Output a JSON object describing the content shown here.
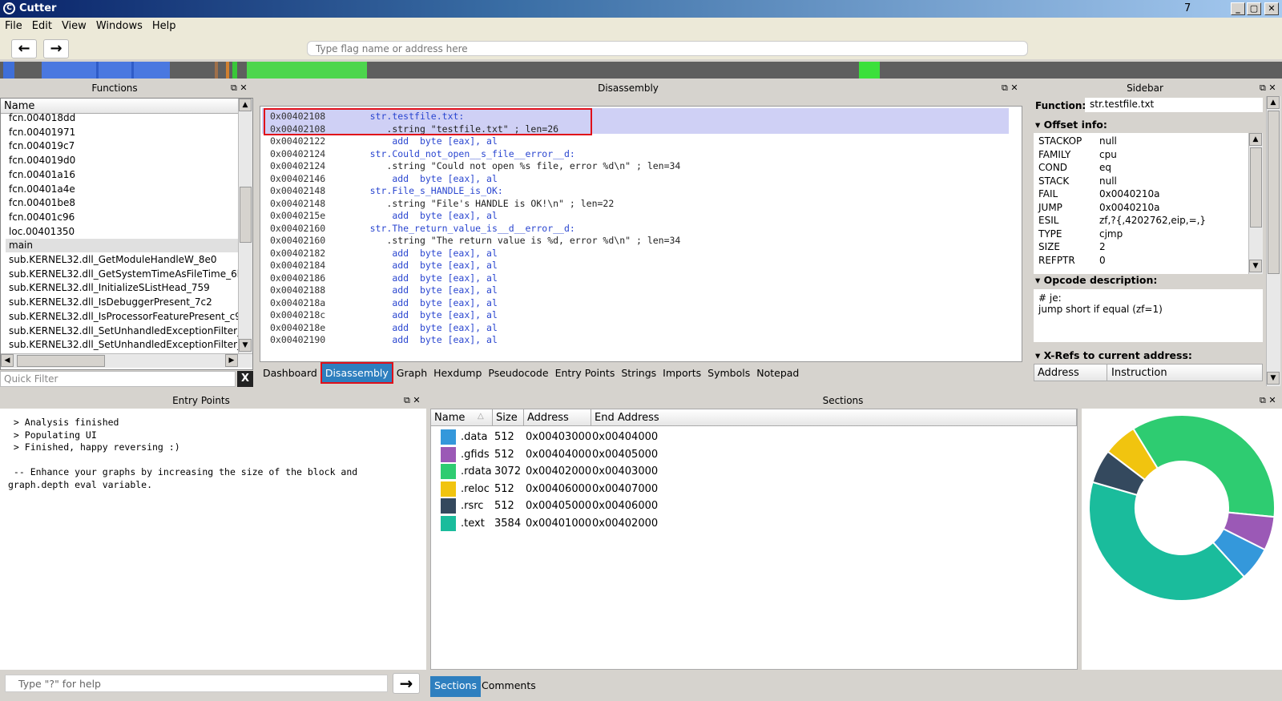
{
  "app": {
    "title": "Cutter",
    "title_number": "7",
    "logo": "C"
  },
  "window_controls": [
    "_",
    "▢",
    "✕"
  ],
  "menu": [
    "File",
    "Edit",
    "View",
    "Windows",
    "Help"
  ],
  "toolbar": {
    "back_icon": "←",
    "forward_icon": "→",
    "search_placeholder": "Type flag name or address here"
  },
  "panels": {
    "functions": "Functions",
    "disassembly": "Disassembly",
    "sidebar": "Sidebar",
    "entry_points": "Entry Points",
    "sections": "Sections"
  },
  "functions": {
    "header": "Name",
    "items": [
      "fcn.004018dd",
      "fcn.00401971",
      "fcn.004019c7",
      "fcn.004019d0",
      "fcn.00401a16",
      "fcn.00401a4e",
      "fcn.00401be8",
      "fcn.00401c96",
      "loc.00401350",
      "main",
      "sub.KERNEL32.dll_GetModuleHandleW_8e0",
      "sub.KERNEL32.dll_GetSystemTimeAsFileTime_6b3",
      "sub.KERNEL32.dll_InitializeSListHead_759",
      "sub.KERNEL32.dll_IsDebuggerPresent_7c2",
      "sub.KERNEL32.dll_IsProcessorFeaturePresent_c90",
      "sub.KERNEL32.dll_SetUnhandledExceptionFilter_328",
      "sub.KERNEL32.dll_SetUnhandledExceptionFilter_924"
    ],
    "selected": "main",
    "filter_placeholder": "Quick Filter",
    "clear_label": "X"
  },
  "disasm": {
    "lines": [
      {
        "addr": "0x00402108",
        "code": "        str.testfile.txt:",
        "kind": "label"
      },
      {
        "addr": "0x00402108",
        "code": "           .string \"testfile.txt\" ; len=26",
        "kind": "string"
      },
      {
        "addr": "0x00402122",
        "code": "            add  byte [eax], al",
        "kind": "ins"
      },
      {
        "addr": "0x00402124",
        "code": "        str.Could_not_open__s_file__error__d:",
        "kind": "label"
      },
      {
        "addr": "0x00402124",
        "code": "           .string \"Could not open %s file, error %d\\n\" ; len=34",
        "kind": "string"
      },
      {
        "addr": "0x00402146",
        "code": "            add  byte [eax], al",
        "kind": "ins"
      },
      {
        "addr": "0x00402148",
        "code": "        str.File_s_HANDLE_is_OK:",
        "kind": "label"
      },
      {
        "addr": "0x00402148",
        "code": "           .string \"File's HANDLE is OK!\\n\" ; len=22",
        "kind": "string"
      },
      {
        "addr": "0x0040215e",
        "code": "            add  byte [eax], al",
        "kind": "ins"
      },
      {
        "addr": "0x00402160",
        "code": "        str.The_return_value_is__d__error__d:",
        "kind": "label"
      },
      {
        "addr": "0x00402160",
        "code": "           .string \"The return value is %d, error %d\\n\" ; len=34",
        "kind": "string"
      },
      {
        "addr": "0x00402182",
        "code": "            add  byte [eax], al",
        "kind": "ins"
      },
      {
        "addr": "0x00402184",
        "code": "            add  byte [eax], al",
        "kind": "ins"
      },
      {
        "addr": "0x00402186",
        "code": "            add  byte [eax], al",
        "kind": "ins"
      },
      {
        "addr": "0x00402188",
        "code": "            add  byte [eax], al",
        "kind": "ins"
      },
      {
        "addr": "0x0040218a",
        "code": "            add  byte [eax], al",
        "kind": "ins"
      },
      {
        "addr": "0x0040218c",
        "code": "            add  byte [eax], al",
        "kind": "ins"
      },
      {
        "addr": "0x0040218e",
        "code": "            add  byte [eax], al",
        "kind": "ins"
      },
      {
        "addr": "0x00402190",
        "code": "            add  byte [eax], al",
        "kind": "ins"
      }
    ]
  },
  "tabs": [
    "Dashboard",
    "Disassembly",
    "Graph",
    "Hexdump",
    "Pseudocode",
    "Entry Points",
    "Strings",
    "Imports",
    "Symbols",
    "Notepad"
  ],
  "active_tab": "Disassembly",
  "sidebar": {
    "function_label": "Function:",
    "function_value": "str.testfile.txt",
    "offset_header": "Offset info:",
    "offset_info": [
      {
        "k": "STACKOP",
        "v": "null"
      },
      {
        "k": "FAMILY",
        "v": "cpu"
      },
      {
        "k": "COND",
        "v": "eq"
      },
      {
        "k": "STACK",
        "v": "null"
      },
      {
        "k": "FAIL",
        "v": "0x0040210a"
      },
      {
        "k": "JUMP",
        "v": "0x0040210a"
      },
      {
        "k": "ESIL",
        "v": "zf,?{,4202762,eip,=,}"
      },
      {
        "k": "TYPE",
        "v": "cjmp"
      },
      {
        "k": "SIZE",
        "v": "2"
      },
      {
        "k": "REFPTR",
        "v": "0"
      }
    ],
    "opcode_header": "Opcode description:",
    "opcode_lines": [
      "# je:",
      "jump short if equal (zf=1)"
    ],
    "xrefs_header": "X-Refs to current address:",
    "xrefs_cols": [
      "Address",
      "Instruction"
    ]
  },
  "console": {
    "lines": [
      " > Analysis finished",
      " > Populating UI",
      " > Finished, happy reversing :)",
      "",
      " -- Enhance your graphs by increasing the size of the block and",
      "graph.depth eval variable."
    ],
    "input_placeholder": "Type \"?\" for help",
    "run_icon": "→"
  },
  "sections": {
    "columns": [
      "Name",
      "Size",
      "Address",
      "End Address"
    ],
    "rows": [
      {
        "name": ".data",
        "size": "512",
        "addr": "0x00403000",
        "end": "0x00404000",
        "color": "#3498db"
      },
      {
        "name": ".gfids",
        "size": "512",
        "addr": "0x00404000",
        "end": "0x00405000",
        "color": "#9b59b6"
      },
      {
        "name": ".rdata",
        "size": "3072",
        "addr": "0x00402000",
        "end": "0x00403000",
        "color": "#2ecc71"
      },
      {
        "name": ".reloc",
        "size": "512",
        "addr": "0x00406000",
        "end": "0x00407000",
        "color": "#f1c40f"
      },
      {
        "name": ".rsrc",
        "size": "512",
        "addr": "0x00405000",
        "end": "0x00406000",
        "color": "#34495e"
      },
      {
        "name": ".text",
        "size": "3584",
        "addr": "0x00401000",
        "end": "0x00402000",
        "color": "#1abc9c"
      }
    ],
    "bottom_tabs": [
      "Sections",
      "Comments"
    ],
    "active_bottom_tab": "Sections"
  },
  "chart_data": {
    "type": "pie",
    "categories": [
      ".data",
      ".gfids",
      ".rdata",
      ".reloc",
      ".rsrc",
      ".text"
    ],
    "values": [
      512,
      512,
      3072,
      512,
      512,
      3584
    ],
    "colors": [
      "#3498db",
      "#9b59b6",
      "#2ecc71",
      "#f1c40f",
      "#34495e",
      "#1abc9c"
    ],
    "donut": true
  }
}
